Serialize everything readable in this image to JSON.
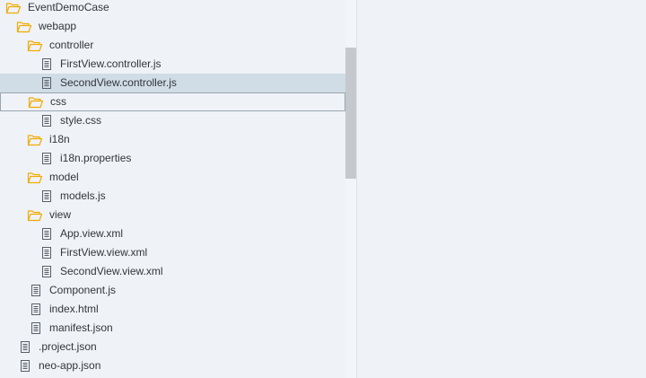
{
  "colors": {
    "folder_icon": "#f0ab00",
    "file_icon": "#5a5f66",
    "selected_row": "#d0dce6",
    "scrollbar_thumb": "#c5c8cc",
    "text": "#32363a"
  },
  "tree": {
    "items": [
      {
        "label": "EventDemoCase",
        "type": "folder",
        "icon": "folder-open-icon",
        "depth": 0
      },
      {
        "label": "webapp",
        "type": "folder",
        "icon": "folder-open-icon",
        "depth": 1
      },
      {
        "label": "controller",
        "type": "folder",
        "icon": "folder-open-icon",
        "depth": 2
      },
      {
        "label": "FirstView.controller.js",
        "type": "file",
        "icon": "file-icon",
        "depth": 3
      },
      {
        "label": "SecondView.controller.js",
        "type": "file",
        "icon": "file-icon",
        "depth": 3,
        "selected": true
      },
      {
        "label": "css",
        "type": "folder",
        "icon": "folder-open-icon",
        "depth": 2,
        "focused": true
      },
      {
        "label": "style.css",
        "type": "file",
        "icon": "file-icon",
        "depth": 3
      },
      {
        "label": "i18n",
        "type": "folder",
        "icon": "folder-open-icon",
        "depth": 2
      },
      {
        "label": "i18n.properties",
        "type": "file",
        "icon": "file-icon",
        "depth": 3
      },
      {
        "label": "model",
        "type": "folder",
        "icon": "folder-open-icon",
        "depth": 2
      },
      {
        "label": "models.js",
        "type": "file",
        "icon": "file-icon",
        "depth": 3
      },
      {
        "label": "view",
        "type": "folder",
        "icon": "folder-open-icon",
        "depth": 2
      },
      {
        "label": "App.view.xml",
        "type": "file",
        "icon": "file-icon",
        "depth": 3
      },
      {
        "label": "FirstView.view.xml",
        "type": "file",
        "icon": "file-icon",
        "depth": 3
      },
      {
        "label": "SecondView.view.xml",
        "type": "file",
        "icon": "file-icon",
        "depth": 3
      },
      {
        "label": "Component.js",
        "type": "file",
        "icon": "file-icon",
        "depth": 2
      },
      {
        "label": "index.html",
        "type": "file",
        "icon": "file-icon",
        "depth": 2
      },
      {
        "label": "manifest.json",
        "type": "file",
        "icon": "file-icon",
        "depth": 2
      },
      {
        "label": ".project.json",
        "type": "file",
        "icon": "file-icon",
        "depth": 1
      },
      {
        "label": "neo-app.json",
        "type": "file",
        "icon": "file-icon",
        "depth": 1
      }
    ]
  }
}
